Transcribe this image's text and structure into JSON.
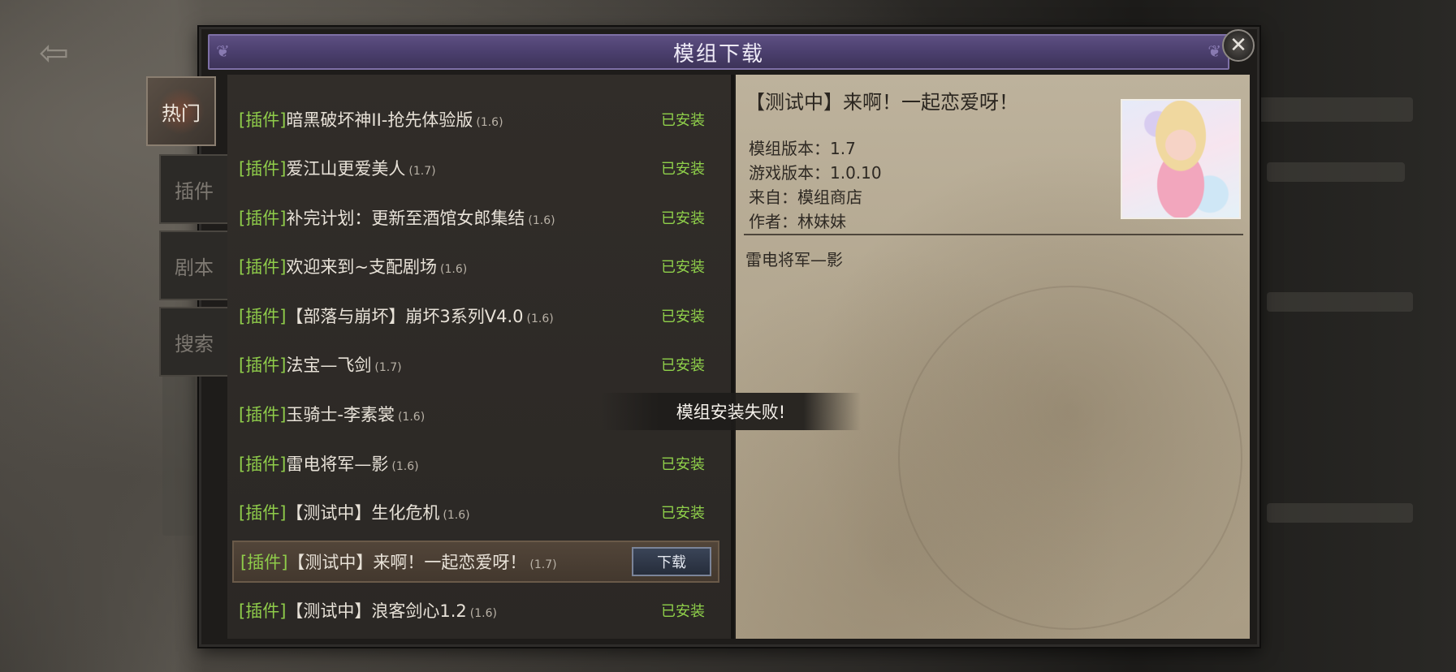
{
  "dialog": {
    "title": "模组下载",
    "close_icon": "close-icon"
  },
  "tabs": [
    {
      "label": "热门",
      "active": true
    },
    {
      "label": "插件",
      "active": false
    },
    {
      "label": "剧本",
      "active": false
    },
    {
      "label": "搜索",
      "active": false
    }
  ],
  "mod_list": [
    {
      "tag": "[插件]",
      "name": "暗黑破坏神II-抢先体验版",
      "version": "(1.6)",
      "status": "已安装"
    },
    {
      "tag": "[插件]",
      "name": "爱江山更爱美人",
      "version": "(1.7)",
      "status": "已安装"
    },
    {
      "tag": "[插件]",
      "name": "补完计划：更新至酒馆女郎集结",
      "version": "(1.6)",
      "status": "已安装"
    },
    {
      "tag": "[插件]",
      "name": "欢迎来到~支配剧场",
      "version": "(1.6)",
      "status": "已安装"
    },
    {
      "tag": "[插件]",
      "name": "【部落与崩坏】崩坏3系列V4.0",
      "version": "(1.6)",
      "status": "已安装"
    },
    {
      "tag": "[插件]",
      "name": "法宝—飞剑",
      "version": "(1.7)",
      "status": "已安装"
    },
    {
      "tag": "[插件]",
      "name": "玉骑士-李素裳",
      "version": "(1.6)",
      "status": ""
    },
    {
      "tag": "[插件]",
      "name": "雷电将军—影",
      "version": "(1.6)",
      "status": "已安装"
    },
    {
      "tag": "[插件]",
      "name": "【测试中】生化危机",
      "version": "(1.6)",
      "status": "已安装"
    },
    {
      "tag": "[插件]",
      "name": "【测试中】来啊！一起恋爱呀！",
      "version": "(1.7)",
      "status": "",
      "button": "下载",
      "selected": true
    },
    {
      "tag": "[插件]",
      "name": "【测试中】浪客剑心1.2",
      "version": "(1.6)",
      "status": "已安装"
    }
  ],
  "detail": {
    "title": "【测试中】来啊！一起恋爱呀！",
    "mod_version": "模组版本：1.7",
    "game_version": "游戏版本：1.0.10",
    "source": "来自：模组商店",
    "author": "作者：林妹妹",
    "description": "雷电将军—影"
  },
  "toast": "模组安装失败!"
}
